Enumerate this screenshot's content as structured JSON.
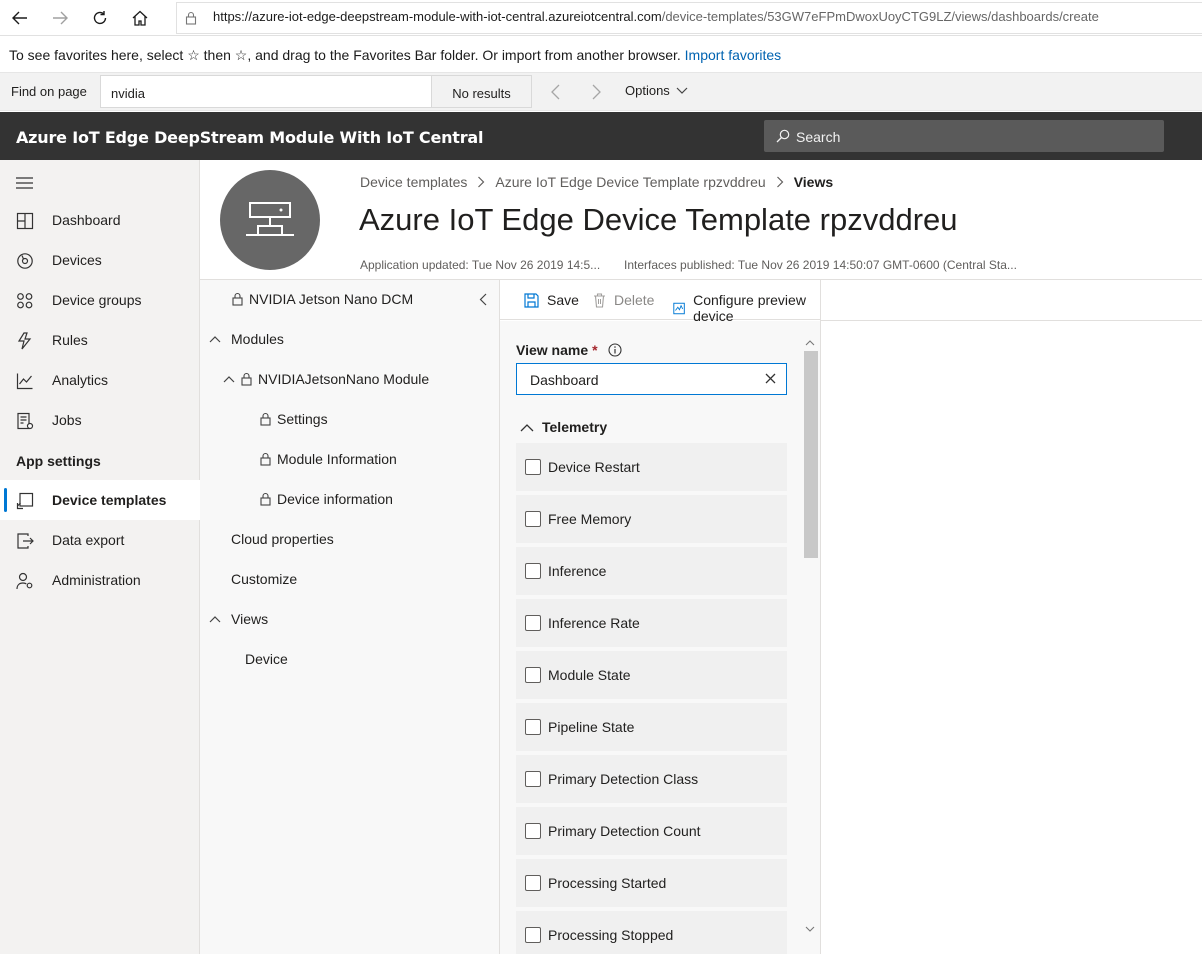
{
  "browser": {
    "url_main": "https://azure-iot-edge-deepstream-module-with-iot-central.azureiotcentral.com",
    "url_rest": "/device-templates/53GW7eFPmDwoxUoyCTG9LZ/views/dashboards/create",
    "icons": [
      "back-icon",
      "forward-icon",
      "refresh-icon",
      "home-icon",
      "lock-icon"
    ]
  },
  "favorites": {
    "text_part1": "To see favorites here, select ",
    "text_part2": " then ",
    "text_part3": ", and drag to the Favorites Bar folder. Or import from another browser. ",
    "import_link": "Import favorites"
  },
  "find": {
    "label": "Find on page",
    "value": "nvidia",
    "result": "No results",
    "options_label": "Options"
  },
  "header": {
    "app_title": "Azure IoT Edge DeepStream Module With IoT Central",
    "search_placeholder": "Search"
  },
  "sidebar": {
    "items": [
      {
        "label": "Dashboard",
        "icon": "dashboard-icon"
      },
      {
        "label": "Devices",
        "icon": "devices-icon"
      },
      {
        "label": "Device groups",
        "icon": "device-groups-icon"
      },
      {
        "label": "Rules",
        "icon": "rules-icon"
      },
      {
        "label": "Analytics",
        "icon": "analytics-icon"
      },
      {
        "label": "Jobs",
        "icon": "jobs-icon"
      }
    ],
    "section_label": "App settings",
    "settings_items": [
      {
        "label": "Device templates",
        "icon": "device-templates-icon",
        "active": true
      },
      {
        "label": "Data export",
        "icon": "data-export-icon"
      },
      {
        "label": "Administration",
        "icon": "administration-icon"
      }
    ]
  },
  "page": {
    "breadcrumb": [
      "Device templates",
      "Azure IoT Edge Device Template rpzvddreu",
      "Views"
    ],
    "title": "Azure IoT Edge Device Template rpzvddreu",
    "app_updated": "Application updated: Tue Nov 26 2019 14:5...",
    "interfaces_published": "Interfaces published: Tue Nov 26 2019 14:50:07 GMT-0600 (Central Sta..."
  },
  "tree": {
    "dcm": "NVIDIA Jetson Nano DCM",
    "modules": "Modules",
    "module": "NVIDIAJetsonNano Module",
    "settings": "Settings",
    "module_information": "Module Information",
    "device_information": "Device information",
    "cloud_properties": "Cloud properties",
    "customize": "Customize",
    "views": "Views",
    "device": "Device"
  },
  "toolbar": {
    "save": "Save",
    "delete": "Delete",
    "configure": "Configure preview device"
  },
  "form": {
    "view_name_label": "View name",
    "required_mark": "*",
    "view_name_value": "Dashboard",
    "telemetry_header": "Telemetry",
    "telemetry": [
      "Device Restart",
      "Free Memory",
      "Inference",
      "Inference Rate",
      "Module State",
      "Pipeline State",
      "Primary Detection Class",
      "Primary Detection Count",
      "Processing Started",
      "Processing Stopped"
    ]
  },
  "colors": {
    "header_bg": "#333333",
    "accent": "#0078d4",
    "sidebar_bg": "#f3f2f1"
  }
}
